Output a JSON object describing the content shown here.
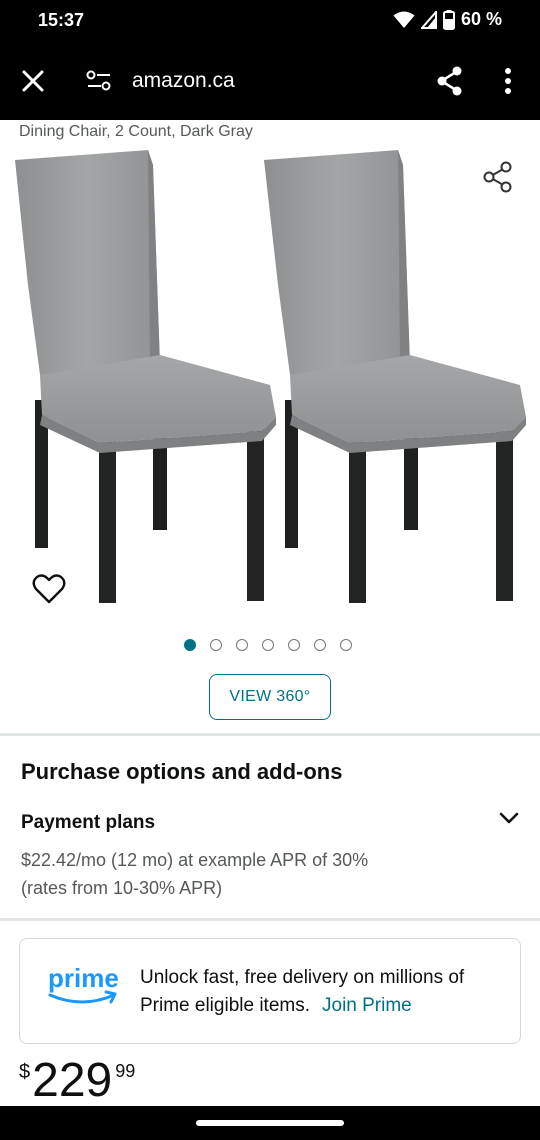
{
  "status": {
    "time": "15:37",
    "battery_text": "60 %",
    "icons": [
      "wifi-icon",
      "cell-signal-icon",
      "battery-icon"
    ]
  },
  "browser": {
    "url": "amazon.ca",
    "icons": [
      "close-icon",
      "page-controls-icon",
      "share-icon",
      "more-options-icon"
    ]
  },
  "product": {
    "title": "Dining Chair, 2 Count, Dark Gray",
    "image_count": 7,
    "active_image_index": 0,
    "view360_label": "VIEW 360°"
  },
  "purchase": {
    "heading": "Purchase options and add-ons",
    "payment_title": "Payment plans",
    "payment_detail": "$22.42/mo (12 mo) at example APR of 30% (rates from 10-30% APR)"
  },
  "prime": {
    "logo_text": "prime",
    "text": "Unlock fast, free delivery on millions of Prime eligible items.",
    "link": "Join Prime"
  },
  "price": {
    "symbol": "$",
    "whole": "229",
    "fraction": "99"
  },
  "colors": {
    "accent": "#007185",
    "prime_blue": "#1a98ff",
    "chair_fabric": "#9a9c9d",
    "chair_legs": "#1e2020"
  }
}
